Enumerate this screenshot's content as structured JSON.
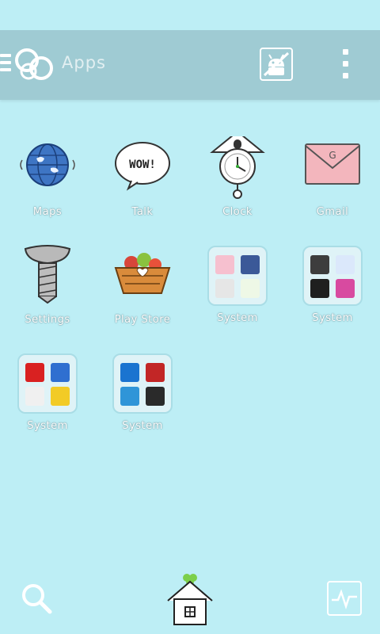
{
  "topbar": {
    "title": "Apps"
  },
  "apps": [
    {
      "label": "Maps"
    },
    {
      "label": "Talk"
    },
    {
      "label": "Clock"
    },
    {
      "label": "Gmail"
    },
    {
      "label": "Settings"
    },
    {
      "label": "Play Store"
    },
    {
      "label": "System"
    },
    {
      "label": "System"
    },
    {
      "label": "System"
    },
    {
      "label": "System"
    }
  ],
  "talk_bubble_text": "WOW!",
  "colors": {
    "background": "#bdeef5",
    "topbar": "#9fcbd3",
    "label": "#ffffff"
  },
  "icons": {
    "maps": "globe-icon",
    "talk": "speech-bubble-icon",
    "clock": "cuckoo-clock-icon",
    "gmail": "envelope-icon",
    "settings": "screw-icon",
    "play_store": "basket-icon",
    "search": "magnifier-icon",
    "home": "house-icon",
    "activity": "pulse-icon"
  }
}
